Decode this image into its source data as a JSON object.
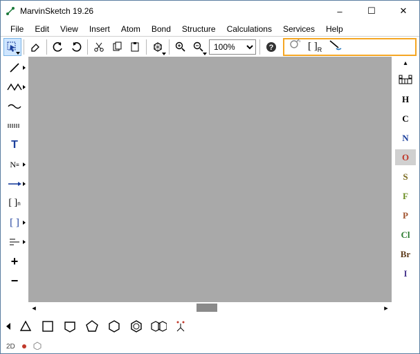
{
  "window": {
    "title": "MarvinSketch 19.26",
    "controls": {
      "minimize": "–",
      "maximize": "☐",
      "close": "✕"
    }
  },
  "menu": [
    "File",
    "Edit",
    "View",
    "Insert",
    "Atom",
    "Bond",
    "Structure",
    "Calculations",
    "Services",
    "Help"
  ],
  "toolbar": {
    "select": "select-tool",
    "erase": "erase-tool",
    "undo": "undo",
    "redo": "redo",
    "cut": "cut",
    "copy": "copy",
    "paste": "paste",
    "clean": "clean",
    "zoom_in": "zoom-in",
    "zoom_out": "zoom-out",
    "zoom_value": "100%",
    "help": "help"
  },
  "highlight_tools": [
    "group1",
    "group2",
    "group3"
  ],
  "left_tools": {
    "bond": "/",
    "chain_zig": "chain",
    "chain_wave": "wave",
    "tick": "tick",
    "text": "T",
    "name": "N",
    "arrow": "arrow",
    "bracket_n": "[ ]",
    "bracket": "[ ]",
    "align": "align",
    "plus": "+",
    "minus": "−"
  },
  "elements": [
    {
      "sym": "H",
      "color": "#000"
    },
    {
      "sym": "C",
      "color": "#000"
    },
    {
      "sym": "N",
      "color": "#1b3f9c"
    },
    {
      "sym": "O",
      "color": "#c0392b"
    },
    {
      "sym": "S",
      "color": "#7a6a1f"
    },
    {
      "sym": "F",
      "color": "#6b8e23"
    },
    {
      "sym": "P",
      "color": "#a0522d"
    },
    {
      "sym": "Cl",
      "color": "#2e7d32"
    },
    {
      "sym": "Br",
      "color": "#5d3a1a"
    },
    {
      "sym": "I",
      "color": "#4b3a8f"
    }
  ],
  "right_top_icon": "periodic",
  "bottom_shapes": [
    "triangle",
    "square",
    "pentagon-outline",
    "pentagon",
    "hexagon",
    "benzene",
    "fused",
    "radical"
  ],
  "status": {
    "mode": "2D"
  }
}
